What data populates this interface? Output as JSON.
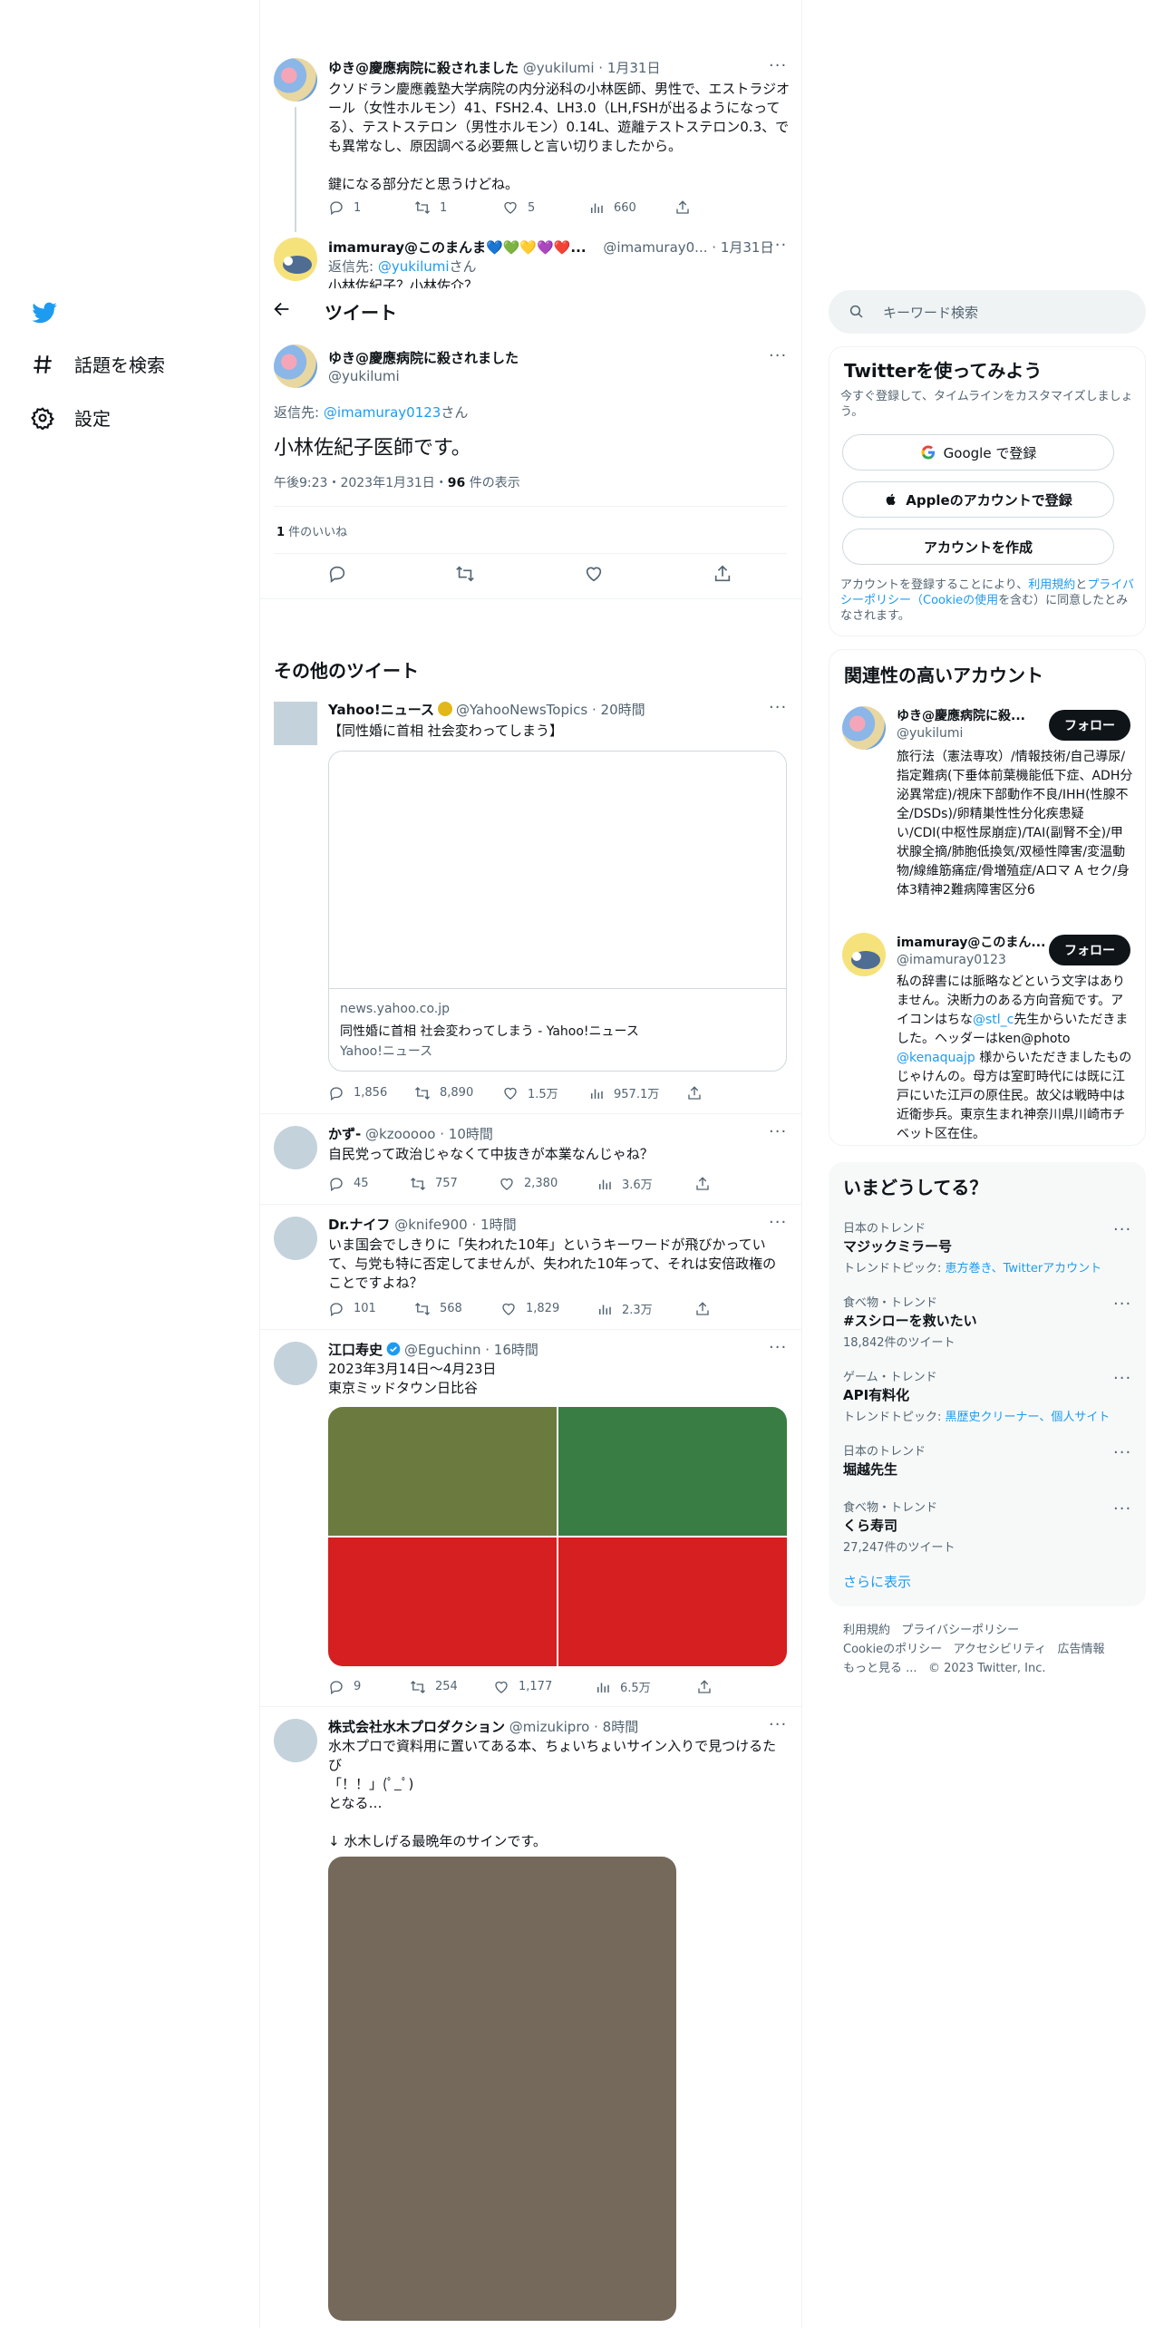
{
  "nav": {
    "explore_label": "話題を検索",
    "settings_label": "設定"
  },
  "thread": {
    "parent": {
      "name": "ゆき@慶應病院に殺されました",
      "handle": "@yukilumi",
      "time": "1月31日",
      "text": "クソドラン慶應義塾大学病院の内分泌科の小林医師、男性で、エストラジオール（女性ホルモン）41、FSH2.4、LH3.0（LH,FSHが出るようになってる）、テストステロン（男性ホルモン）0.14L、遊離テストステロン0.3、でも異常なし、原因調べる必要無しと言い切りましたから。\n\n鍵になる部分だと思うけどね。",
      "replies": "1",
      "retweets": "1",
      "likes": "5",
      "views": "660"
    },
    "second": {
      "name": "imamuray@このまんま💙💚💛💜❤️...",
      "handle": "@imamuray0...",
      "time": "1月31日",
      "reply_prefix": "返信先: ",
      "reply_to": "@yukilumi",
      "reply_suffix": "さん",
      "text_partial": "小林佐紀子？小林佐介？"
    }
  },
  "header": {
    "title": "ツイート"
  },
  "main_tweet": {
    "name": "ゆき@慶應病院に殺されました",
    "handle": "@yukilumi",
    "reply_prefix": "返信先: ",
    "reply_to": "@imamuray0123",
    "reply_suffix": "さん",
    "text": "小林佐紀子医師です。",
    "timestamp": "午後9:23・2023年1月31日・",
    "views_count": "96",
    "views_label": " 件の表示",
    "likes_count": "1",
    "likes_label": " 件のいいね"
  },
  "more_tweets_title": "その他のツイート",
  "tweets": [
    {
      "name": "Yahoo!ニュース",
      "handle": "@YahooNewsTopics",
      "time": "20時間",
      "text": "【同性婚に首相 社会変わってしまう】",
      "card_domain": "news.yahoo.co.jp",
      "card_title": "同性婚に首相 社会変わってしまう - Yahoo!ニュース",
      "card_desc": "Yahoo!ニュース",
      "replies": "1,856",
      "retweets": "8,890",
      "likes": "1.5万",
      "views": "957.1万"
    },
    {
      "name": "かず-",
      "handle": "@kzooooo",
      "time": "10時間",
      "text": "自民党って政治じゃなくて中抜きが本業なんじゃね？",
      "replies": "45",
      "retweets": "757",
      "likes": "2,380",
      "views": "3.6万"
    },
    {
      "name": "Dr.ナイフ",
      "handle": "@knife900",
      "time": "1時間",
      "text": "いま国会でしきりに「失われた10年」というキーワードが飛びかっていて、与党も特に否定してませんが、失われた10年って、それは安倍政権のことですよね？",
      "replies": "101",
      "retweets": "568",
      "likes": "1,829",
      "views": "2.3万"
    },
    {
      "name": "江口寿史",
      "handle": "@Eguchinn",
      "time": "16時間",
      "text": "2023年3月14日〜4月23日\n東京ミッドタウン日比谷",
      "replies": "9",
      "retweets": "254",
      "likes": "1,177",
      "views": "6.5万"
    },
    {
      "name": "株式会社水木プロダクション",
      "handle": "@mizukipro",
      "time": "8時間",
      "text": "水木プロで資料用に置いてある本、ちょいちょいサイン入りで見つけるたび\n「！！」(ﾟ_ﾟ)\nとなる…\n\n↓ 水木しげる最晩年のサインです。"
    }
  ],
  "search": {
    "placeholder": "キーワード検索"
  },
  "signup": {
    "title": "Twitterを使ってみよう",
    "subtitle": "今すぐ登録して、タイムラインをカスタマイズしましょう。",
    "google": "Google で登録",
    "apple": "Appleのアカウントで登録",
    "create": "アカウントを作成",
    "legal_1": "アカウントを登録することにより、",
    "legal_terms": "利用規約",
    "legal_2": "と",
    "legal_privacy": "プライバシーポリシー（Cookieの使用",
    "legal_3": "を含む）に同意したとみなされます。"
  },
  "related": {
    "title": "関連性の高いアカウント",
    "follow_label": "フォロー",
    "accounts": [
      {
        "name": "ゆき@慶應病院に殺...",
        "handle": "@yukilumi",
        "bio": "旅行法（憲法専攻）/情報技術/自己導尿/指定難病(下垂体前葉機能低下症、ADH分泌異常症)/視床下部動作不良/IHH(性腺不全/DSDs)/卵精巣性性分化疾患疑い/CDI(中枢性尿崩症)/TAI(副腎不全)/甲状腺全摘/肺胞低換気/双極性障害/変温動物/線維筋痛症/骨増殖症/Aロマ A セク/身体3精神2難病障害区分6"
      },
      {
        "name": "imamuray@このまん...",
        "handle": "@imamuray0123",
        "bio_1": "私の辞書には脈略などという文字はありません。決断力のある方向音痴です。アイコンはちな",
        "bio_link1": "@stl_c",
        "bio_2": "先生からいただきました。ヘッダーはken@photo ",
        "bio_link2": "@kenaquajp",
        "bio_3": " 様からいただきましたものじゃけんの。母方は室町時代には既に江戸にいた江戸の原住民。故父は戦時中は近衛歩兵。東京生まれ神奈川県川崎市チベット区在住。"
      }
    ]
  },
  "trends": {
    "title": "いまどうしてる？",
    "items": [
      {
        "meta": "日本のトレンド",
        "name": "マジックミラー号",
        "extra_prefix": "トレンドトピック: ",
        "extra_link": "恵方巻き、Twitterアカウント"
      },
      {
        "meta": "食べ物・トレンド",
        "name": "#スシローを救いたい",
        "extra_plain": "18,842件のツイート"
      },
      {
        "meta": "ゲーム・トレンド",
        "name": "API有料化",
        "extra_prefix": "トレンドトピック: ",
        "extra_link": "黒歴史クリーナー、個人サイト"
      },
      {
        "meta": "日本のトレンド",
        "name": "堀越先生"
      },
      {
        "meta": "食べ物・トレンド",
        "name": "くら寿司",
        "extra_plain": "27,247件のツイート"
      }
    ],
    "show_more": "さらに表示"
  },
  "footer": {
    "terms": "利用規約",
    "privacy": "プライバシーポリシー",
    "cookie": "Cookieのポリシー",
    "accessibility": "アクセシビリティ",
    "ads": "広告情報",
    "more": "もっと見る ...",
    "copyright": "© 2023 Twitter, Inc."
  },
  "colors": {
    "accent": "#1d9bf0",
    "text": "#0f1419",
    "muted": "#536471",
    "image_olive": "#6b7a3e",
    "image_green": "#3a7d44",
    "image_red": "#d51f20",
    "image_brown": "#74695a"
  },
  "icons": [
    "twitter-bird-icon",
    "hashtag-icon",
    "gear-icon",
    "back-arrow-icon",
    "search-icon",
    "reply-icon",
    "retweet-icon",
    "like-icon",
    "views-icon",
    "share-icon",
    "more-icon",
    "verified-icon",
    "google-icon",
    "apple-icon"
  ]
}
